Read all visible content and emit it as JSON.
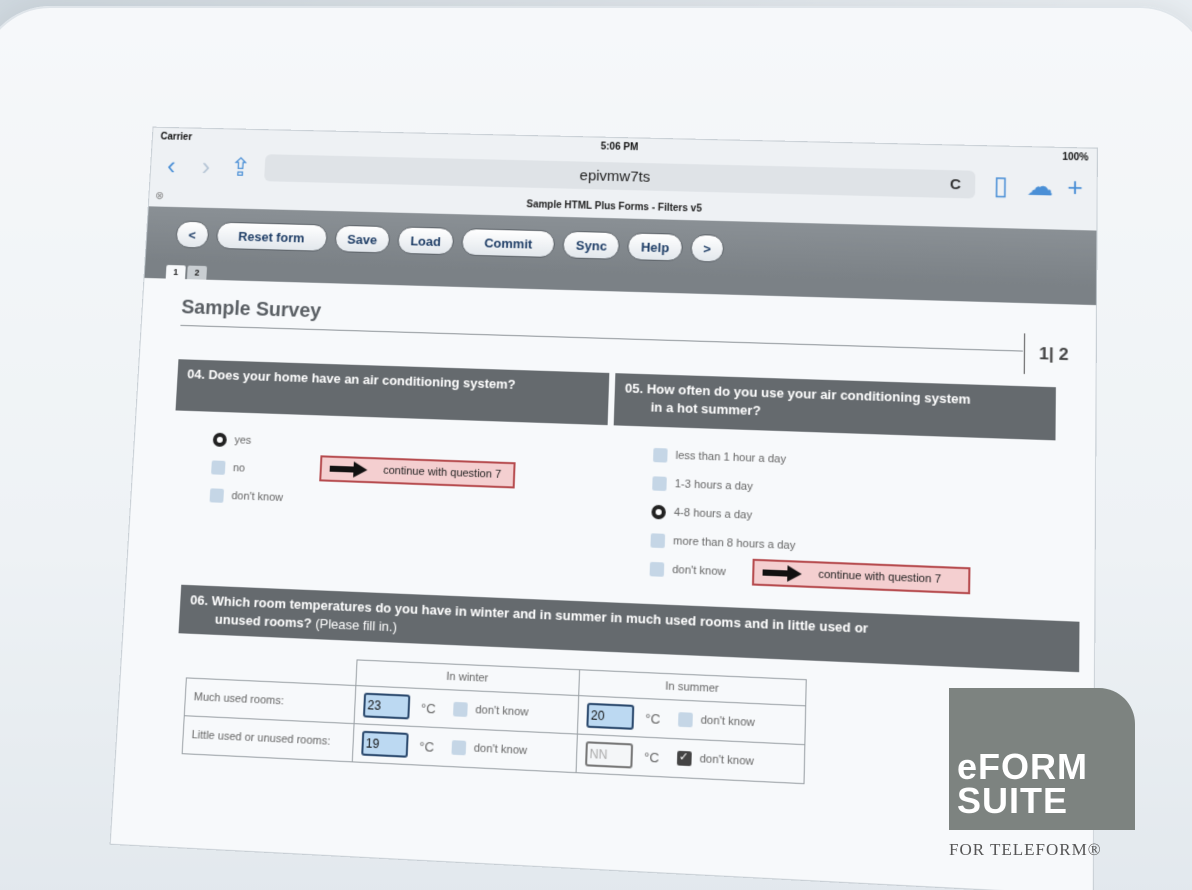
{
  "status": {
    "carrier": "Carrier",
    "time": "5:06 PM",
    "battery": "100%"
  },
  "browser": {
    "url": "epivmw7ts",
    "reload": "C",
    "page_title": "Sample HTML Plus Forms - Filters v5",
    "close": "⊗"
  },
  "toolbar": {
    "prev": "<",
    "reset": "Reset form",
    "save": "Save",
    "load": "Load",
    "commit": "Commit",
    "sync": "Sync",
    "help": "Help",
    "next": ">"
  },
  "tabs": [
    "1",
    "2"
  ],
  "survey": {
    "title": "Sample Survey",
    "page_indicator": "1| 2"
  },
  "q4": {
    "text": "04. Does your home have an air conditioning system?",
    "options": [
      "yes",
      "no",
      "don't know"
    ],
    "selected": "yes",
    "continue": "continue with question 7"
  },
  "q5": {
    "text_line1": "05. How often do you use your air conditioning system",
    "text_line2": "in a hot summer?",
    "options": [
      "less than 1 hour a day",
      "1-3 hours a day",
      "4-8 hours a day",
      "more than 8 hours a day",
      "don't know"
    ],
    "selected": "4-8 hours a day",
    "continue": "continue with question 7"
  },
  "q6": {
    "text_line1": "06. Which room temperatures do you have in winter and in summer in much used  rooms and in little used or",
    "text_line2": "unused rooms?",
    "hint": "(Please fill in.)",
    "col_winter": "In winter",
    "col_summer": "In summer",
    "unit": "°C",
    "dont_know": "don't know",
    "rows": [
      {
        "label": "Much used rooms:",
        "winter": "23",
        "summer": "20",
        "summer_dk": false
      },
      {
        "label": "Little used or unused rooms:",
        "winter": "19",
        "summer": "NN",
        "summer_dk": true
      }
    ]
  },
  "logo": {
    "line1": "eFORM",
    "line2": "SUITE",
    "sub": "FOR TELEFORM®"
  },
  "colors": {
    "accent": "#4a8fd6",
    "header_gray": "#656a6e",
    "continue_red": "#b64b4e",
    "field_blue": "#bcd9f2"
  }
}
